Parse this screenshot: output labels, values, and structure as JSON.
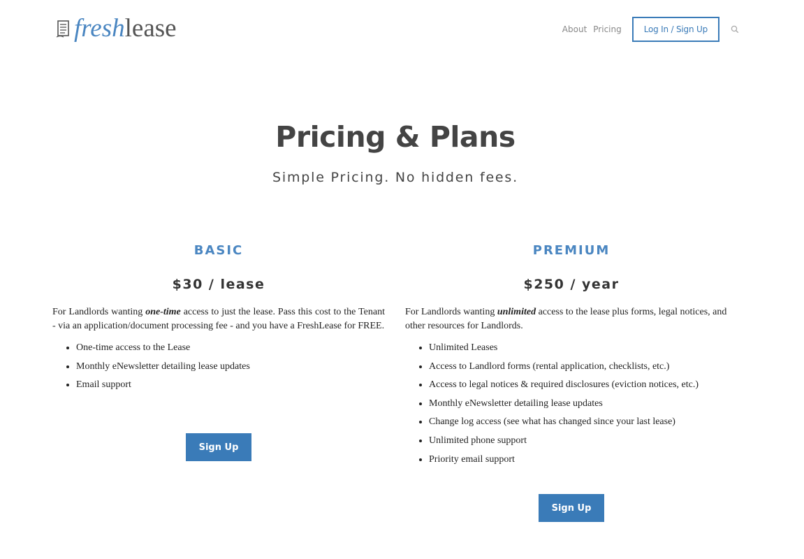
{
  "header": {
    "logo": {
      "fresh": "fresh",
      "lease": "lease",
      "icon": "notepad-icon"
    },
    "nav": {
      "about": "About",
      "pricing": "Pricing",
      "login": "Log In / Sign Up",
      "search_icon": "search-icon"
    }
  },
  "hero": {
    "title": "Pricing & Plans",
    "subtitle": "Simple Pricing. No hidden fees."
  },
  "plans": {
    "basic": {
      "name": "BASIC",
      "price": "$30 / lease",
      "desc_before": "For Landlords wanting ",
      "desc_emphasis": "one-time",
      "desc_after": " access to just the lease.  Pass this cost to the Tenant - via an application/document processing fee - and you have a FreshLease for FREE.",
      "features": [
        "One-time access to the Lease",
        "Monthly eNewsletter detailing lease updates",
        "Email support"
      ],
      "button": "Sign Up"
    },
    "premium": {
      "name": "PREMIUM",
      "price": "$250 / year",
      "desc_before": "For Landlords wanting ",
      "desc_emphasis": "unlimited",
      "desc_after": " access to the lease plus forms, legal notices, and other resources for Landlords.",
      "features": [
        "Unlimited Leases",
        "Access to Landlord forms (rental application, checklists, etc.)",
        "Access to legal notices & required disclosures (eviction notices, etc.)",
        "Monthly eNewsletter detailing lease updates",
        "Change log access (see what has changed since your last lease)",
        "Unlimited phone support",
        "Priority email support"
      ],
      "button": "Sign Up"
    }
  },
  "colors": {
    "brand_blue": "#4a86c1",
    "button_blue": "#3a7bb8",
    "heading_gray": "#444444"
  }
}
